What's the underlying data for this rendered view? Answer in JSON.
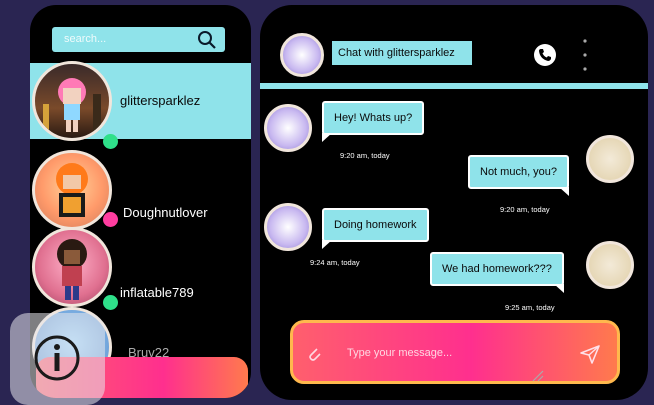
{
  "search": {
    "placeholder": "search..."
  },
  "contacts": [
    {
      "name": "glittersparklez",
      "status_color": "#2fe08a",
      "active": true
    },
    {
      "name": "Doughnutlover",
      "status_color": "#ff3da0",
      "active": false
    },
    {
      "name": "inflatable789",
      "status_color": "#2fe08a",
      "active": false
    },
    {
      "name": "Bruv22",
      "status_color": "#2fe08a",
      "active": false
    }
  ],
  "chat": {
    "title": "Chat with glittersparklez",
    "messages": [
      {
        "from": "them",
        "text": "Hey! Whats up?",
        "time": "9:20 am, today"
      },
      {
        "from": "me",
        "text": "Not much, you?",
        "time": "9:20 am, today"
      },
      {
        "from": "them",
        "text": "Doing homework",
        "time": "9:24 am, today"
      },
      {
        "from": "me",
        "text": "We had homework???",
        "time": "9:25 am, today"
      }
    ],
    "composer_placeholder": "Type your message..."
  },
  "colors": {
    "background": "#2a2552",
    "panel": "#000000",
    "accent": "#8fe3ea",
    "gradient_start": "#ff5f6d",
    "gradient_mid": "#ff2f8e",
    "gradient_end": "#ff7a4d"
  },
  "icons": {
    "search": "search-icon",
    "info": "info-icon",
    "phone": "phone-icon",
    "more": "more-vertical-icon",
    "attach": "paperclip-icon",
    "send": "send-icon"
  }
}
